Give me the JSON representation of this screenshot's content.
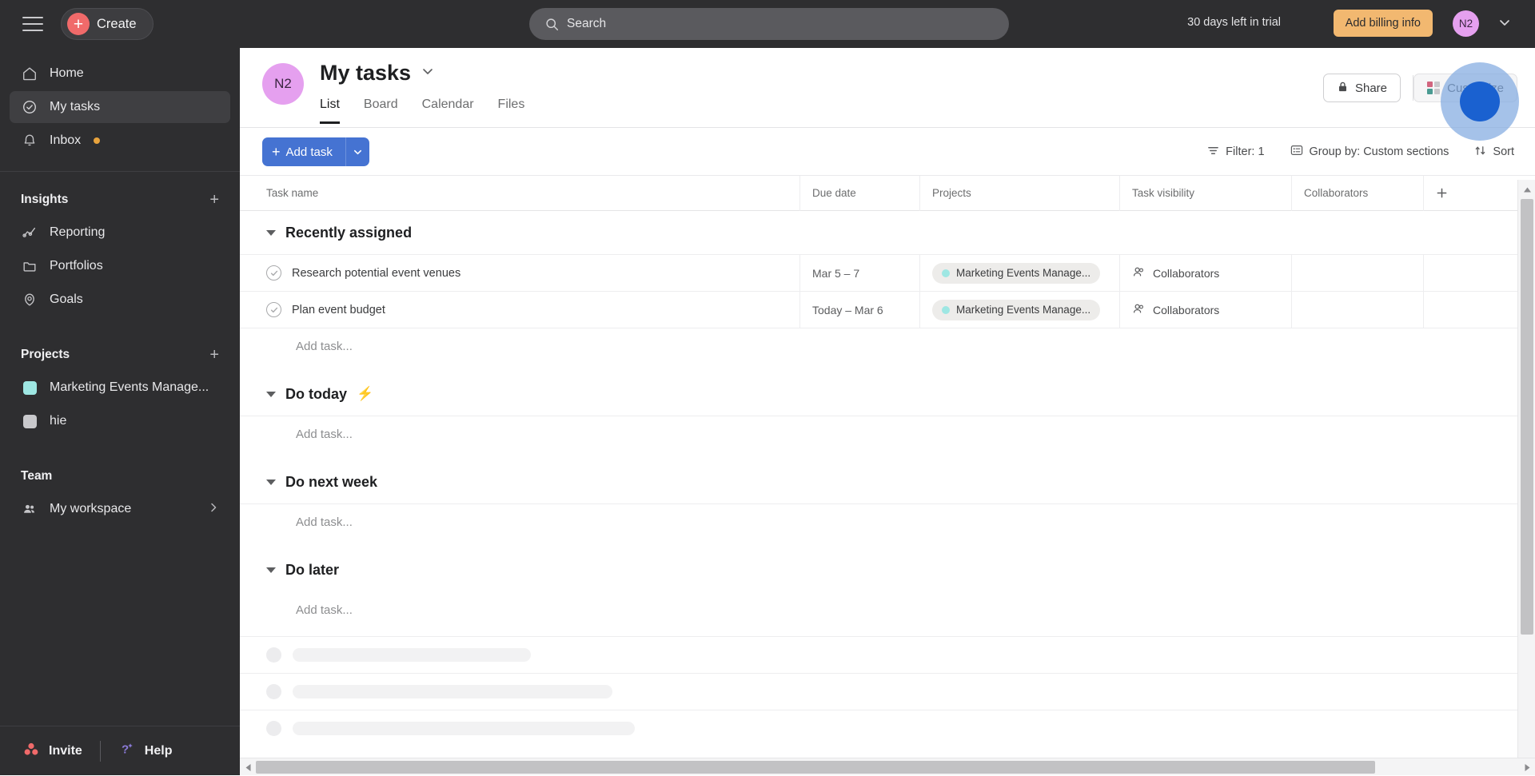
{
  "topbar": {
    "menu_icon": "hamburger-icon",
    "create_label": "Create",
    "search_placeholder": "Search",
    "search_icon": "search-icon",
    "trial_text": "30 days left in trial",
    "billing_label": "Add billing info",
    "avatar_initials": "N2",
    "caret_icon": "chevron-down-icon"
  },
  "sidebar": {
    "nav": [
      {
        "label": "Home",
        "icon": "home-icon",
        "active": false
      },
      {
        "label": "My tasks",
        "icon": "check-circle-icon",
        "active": true
      },
      {
        "label": "Inbox",
        "icon": "bell-icon",
        "active": false,
        "badge": true
      }
    ],
    "insights": {
      "title": "Insights",
      "add_icon": "plus-icon",
      "items": [
        {
          "label": "Reporting",
          "icon": "chart-line-icon"
        },
        {
          "label": "Portfolios",
          "icon": "folder-icon"
        },
        {
          "label": "Goals",
          "icon": "goal-icon"
        }
      ]
    },
    "projects": {
      "title": "Projects",
      "add_icon": "plus-icon",
      "items": [
        {
          "label": "Marketing Events Manage...",
          "color": "#9ee7e3"
        },
        {
          "label": "hie",
          "color": "#c9c9cc"
        }
      ]
    },
    "team": {
      "title": "Team",
      "items": [
        {
          "label": "My workspace",
          "icon": "people-icon",
          "chevron": "chevron-right-icon"
        }
      ]
    },
    "footer": {
      "invite_label": "Invite",
      "invite_icon": "asana-dots-icon",
      "help_label": "Help",
      "help_icon": "question-sparkle-icon"
    }
  },
  "main": {
    "avatar_initials": "N2",
    "title": "My tasks",
    "title_caret": "chevron-down-icon",
    "tabs": [
      {
        "label": "List",
        "active": true
      },
      {
        "label": "Board",
        "active": false
      },
      {
        "label": "Calendar",
        "active": false
      },
      {
        "label": "Files",
        "active": false
      }
    ],
    "share_label": "Share",
    "share_icon": "lock-icon",
    "customize_label": "Customize",
    "customize_icon": "grid-squares-icon",
    "toolbar": {
      "add_task_label": "Add task",
      "add_task_caret": "chevron-down-icon",
      "filter_label": "Filter: 1",
      "filter_icon": "filter-icon",
      "group_label": "Group by: Custom sections",
      "group_icon": "list-icon",
      "sort_label": "Sort",
      "sort_icon": "sort-arrows-icon"
    },
    "columns": [
      "Task name",
      "Due date",
      "Projects",
      "Task visibility",
      "Collaborators"
    ],
    "add_column_icon": "plus-icon",
    "add_task_placeholder": "Add task...",
    "sections": [
      {
        "title": "Recently assigned",
        "emoji": "",
        "tasks": [
          {
            "name": "Research potential event venues",
            "due": "Mar 5 – 7",
            "project": "Marketing Events Manage...",
            "project_color": "#9ee7e3",
            "visibility": "Collaborators",
            "collaborators": ""
          },
          {
            "name": "Plan event budget",
            "due": "Today – Mar 6",
            "project": "Marketing Events Manage...",
            "project_color": "#9ee7e3",
            "visibility": "Collaborators",
            "collaborators": ""
          }
        ]
      },
      {
        "title": "Do today",
        "emoji": "⚡",
        "tasks": []
      },
      {
        "title": "Do next week",
        "emoji": "",
        "tasks": []
      },
      {
        "title": "Do later",
        "emoji": "",
        "tasks": []
      }
    ],
    "skeleton_widths": [
      260,
      400,
      420
    ]
  },
  "colors": {
    "accent_blue": "#4573d2",
    "brand_red": "#f06a6a",
    "avatar_purple": "#e5a0ef",
    "billing_orange": "#f2b870",
    "project_teal": "#9ee7e3",
    "click_indicator": "#1a61d0"
  }
}
